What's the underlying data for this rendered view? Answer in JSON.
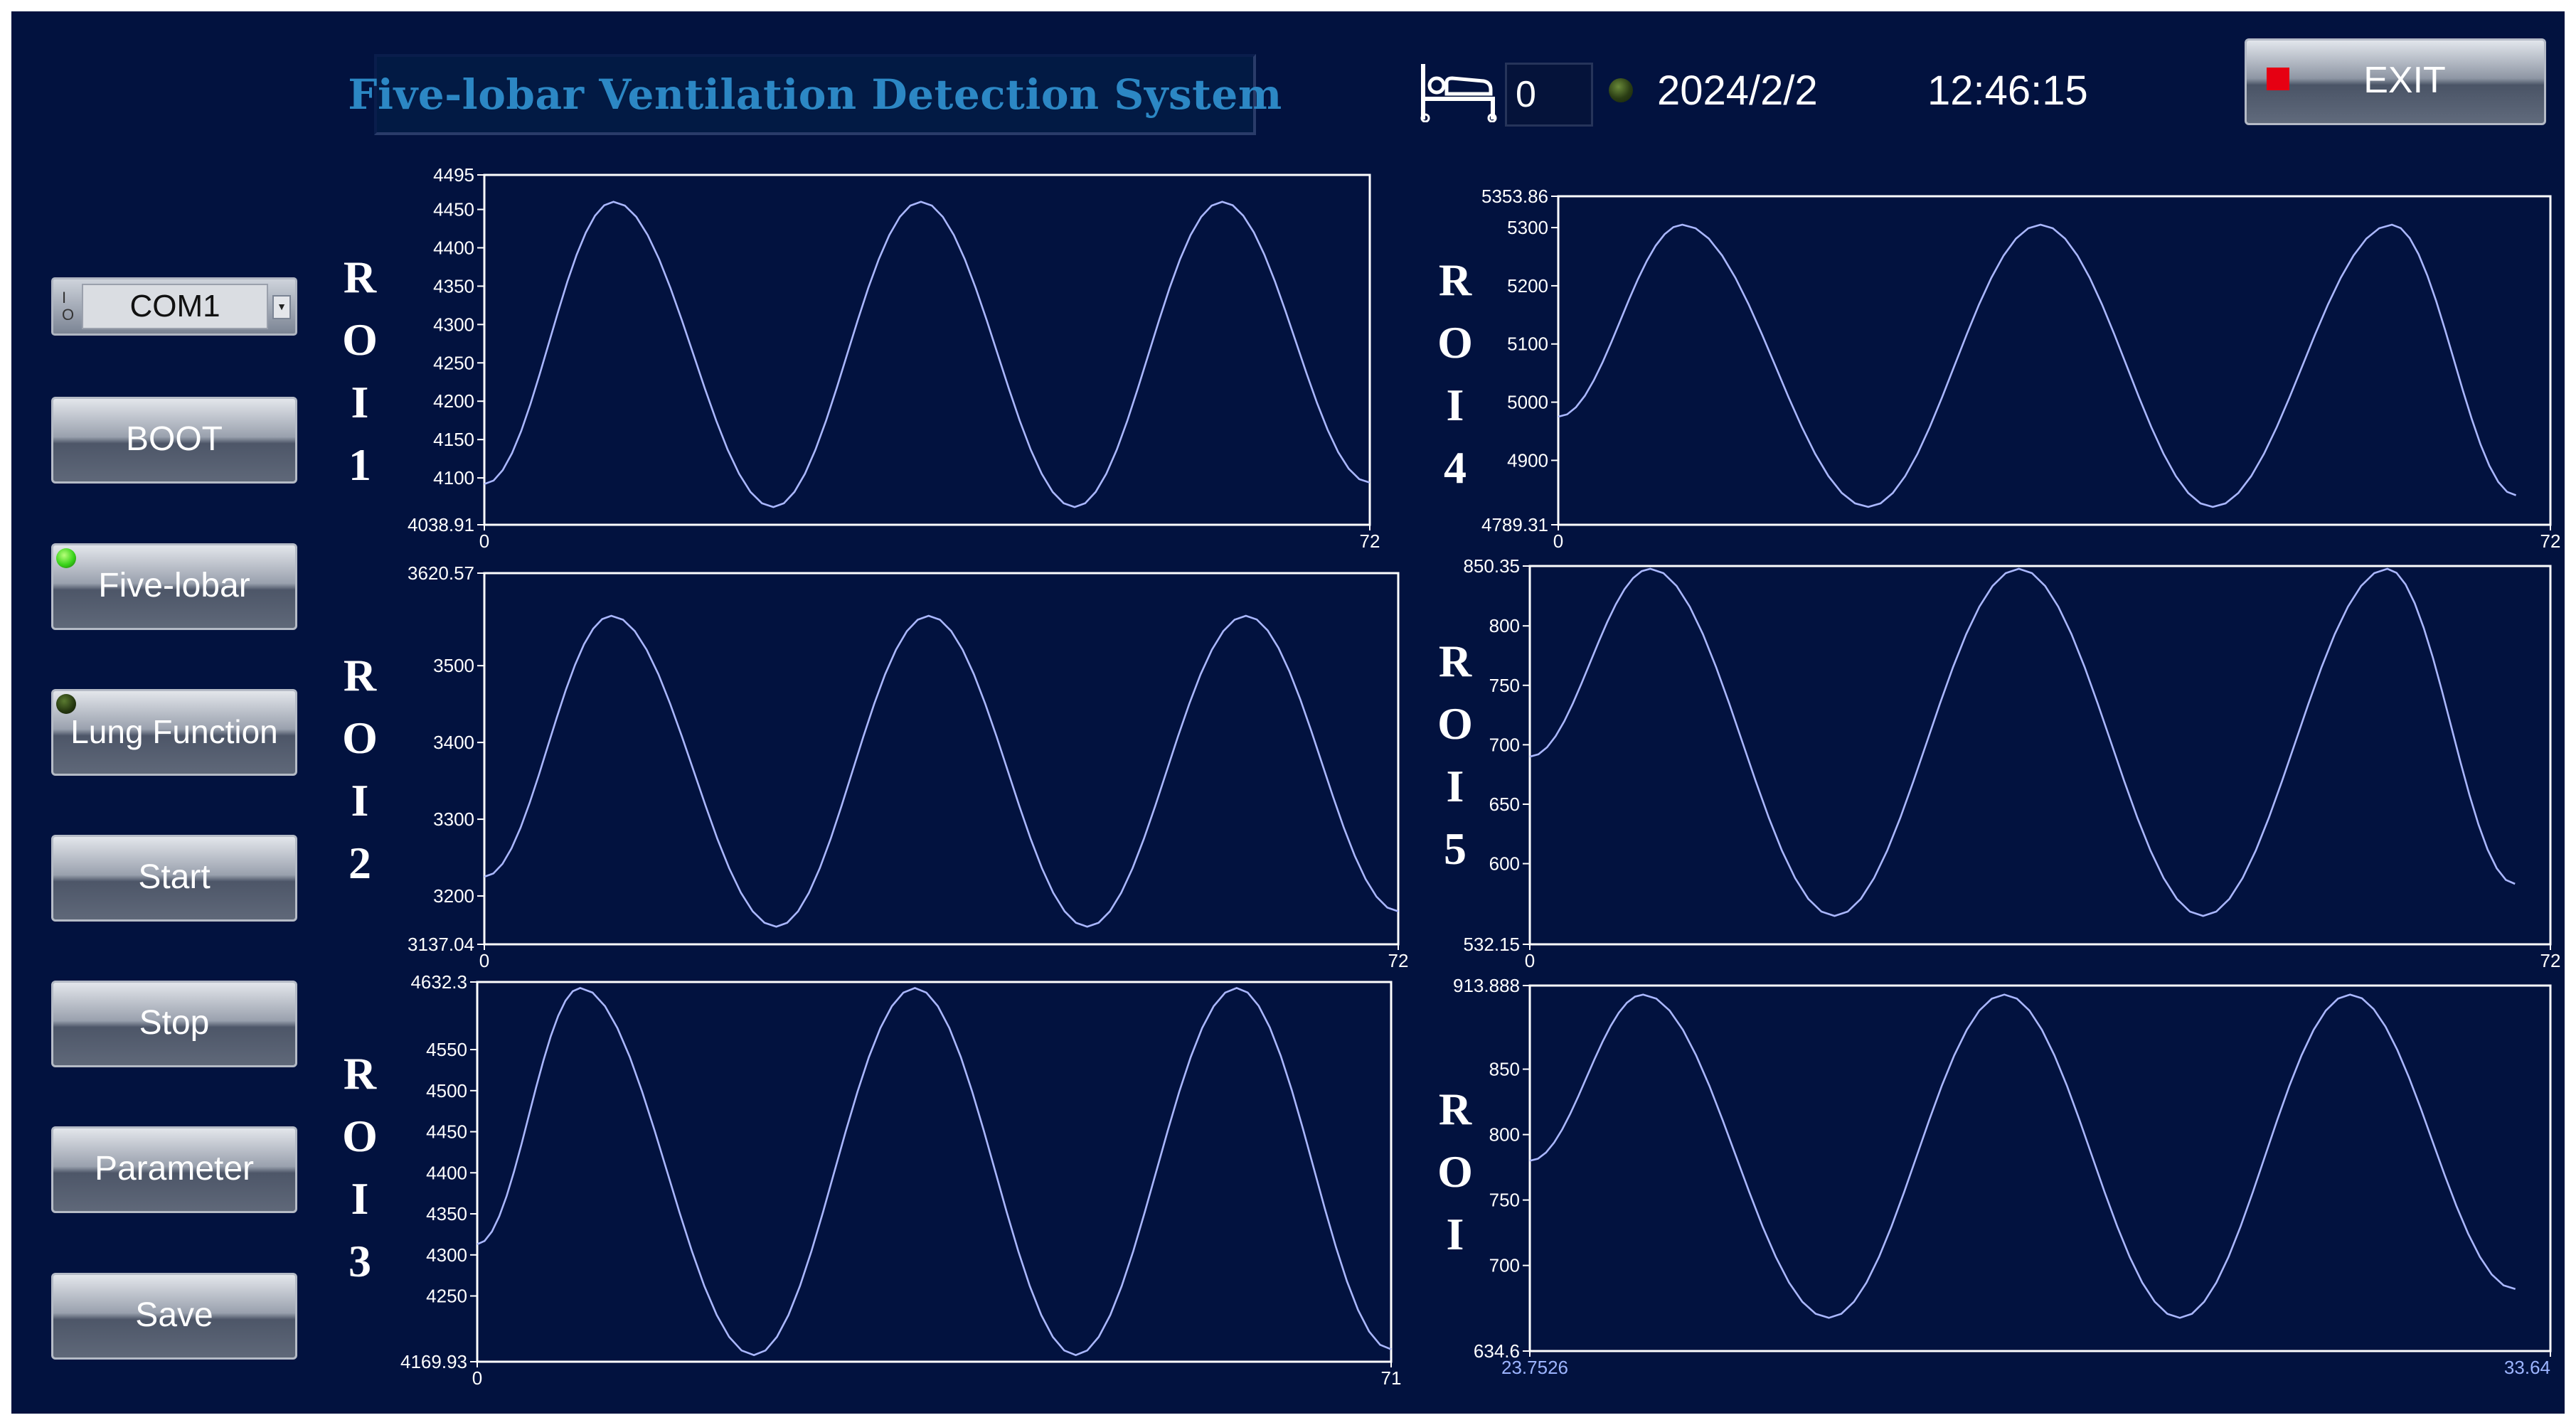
{
  "app": {
    "title": "Five-lobar Ventilation Detection System",
    "bed_count": "0",
    "date": "2024/2/2",
    "time": "12:46:15",
    "exit_label": "EXIT"
  },
  "icons": {
    "bed": "bed-icon",
    "status_led": "led-indicator",
    "exit": "stop-square-icon",
    "io": "io-icon",
    "dropdown": "chevron-down-icon"
  },
  "colors": {
    "background": "#02123f",
    "title": "#2c87c4",
    "trace": "#aab7ff",
    "exit_square": "#e60012",
    "led_on": "#39d31a"
  },
  "sidebar": {
    "port": {
      "value": "COM1"
    },
    "buttons": [
      {
        "label": "BOOT"
      },
      {
        "label": "Five-lobar",
        "indicator": "on"
      },
      {
        "label": "Lung Function",
        "indicator": "off"
      },
      {
        "label": "Start"
      },
      {
        "label": "Stop"
      },
      {
        "label": "Parameter"
      },
      {
        "label": "Save"
      }
    ]
  },
  "roi_labels": [
    [
      "R",
      "O",
      "I",
      "1"
    ],
    [
      "R",
      "O",
      "I",
      "2"
    ],
    [
      "R",
      "O",
      "I",
      "3"
    ],
    [
      "R",
      "O",
      "I",
      "4"
    ],
    [
      "R",
      "O",
      "I",
      "5"
    ],
    [
      "R",
      "O",
      "I"
    ]
  ],
  "chart_data": [
    {
      "type": "line",
      "ymin_label": "4038.91",
      "ymax_label": "4495",
      "ylim": [
        4038.91,
        4495
      ],
      "yticks": [
        "4100",
        "4150",
        "4200",
        "4250",
        "4300",
        "4350",
        "4400",
        "4450"
      ],
      "xlim": [
        0,
        72
      ],
      "xticks": [
        "0",
        "72"
      ],
      "series": [
        {
          "x0": 0,
          "x1": 72,
          "min": 4062,
          "max": 4460,
          "start": 4092,
          "peaks": [
            10.5,
            35.5,
            60.0
          ],
          "troughs": [
            23.5,
            48.0
          ]
        }
      ]
    },
    {
      "type": "line",
      "ymin_label": "3137.04",
      "ymax_label": "3620.57",
      "ylim": [
        3137.04,
        3620.57
      ],
      "yticks": [
        "3200",
        "3300",
        "3400",
        "3500"
      ],
      "xlim": [
        0,
        72
      ],
      "xticks": [
        "0",
        "72"
      ],
      "series": [
        {
          "x0": 0,
          "x1": 72,
          "min": 3160,
          "max": 3565,
          "start": 3225,
          "peaks": [
            10.0,
            35.0,
            60.0
          ],
          "troughs": [
            23.0,
            47.5
          ],
          "end": 3180
        }
      ]
    },
    {
      "type": "line",
      "ymin_label": "4169.93",
      "ymax_label": "4632.3",
      "ylim": [
        4169.93,
        4632.3
      ],
      "yticks": [
        "4250",
        "4300",
        "4350",
        "4400",
        "4450",
        "4500",
        "4550"
      ],
      "xlim": [
        0,
        71
      ],
      "xticks": [
        "0",
        "71"
      ],
      "series": [
        {
          "x0": 0,
          "x1": 71,
          "min": 4178,
          "max": 4625,
          "start": 4313,
          "peaks": [
            8.0,
            34.0,
            59.0
          ],
          "troughs": [
            21.5,
            46.5
          ],
          "end": 4185
        }
      ]
    },
    {
      "type": "line",
      "ymin_label": "4789.31",
      "ymax_label": "5353.86",
      "ylim": [
        4789.31,
        5353.86
      ],
      "yticks": [
        "4900",
        "5000",
        "5100",
        "5200",
        "5300"
      ],
      "xlim": [
        0,
        72
      ],
      "xticks": [
        "0",
        "72"
      ],
      "series": [
        {
          "x0": 0,
          "x1": 69.5,
          "min": 4820,
          "max": 5305,
          "start": 4975,
          "peaks": [
            9.0,
            35.0,
            60.5
          ],
          "troughs": [
            22.5,
            47.5
          ],
          "end": 4840
        }
      ]
    },
    {
      "type": "line",
      "ymin_label": "532.15",
      "ymax_label": "850.35",
      "ylim": [
        532.15,
        850.35
      ],
      "yticks": [
        "600",
        "650",
        "700",
        "750",
        "800"
      ],
      "xlim": [
        0,
        72
      ],
      "xticks": [
        "0",
        "72"
      ],
      "series": [
        {
          "x0": 0,
          "x1": 69.5,
          "min": 556,
          "max": 848,
          "start": 690,
          "peaks": [
            8.5,
            34.5,
            60.5
          ],
          "troughs": [
            21.5,
            47.5
          ],
          "end": 583
        }
      ]
    },
    {
      "type": "line",
      "ymin_label": "634.6",
      "ymax_label": "913.888",
      "ylim": [
        634.6,
        913.888
      ],
      "yticks": [
        "700",
        "750",
        "800",
        "850"
      ],
      "xlim": [
        23.7526,
        33.64
      ],
      "xticks": [
        "23.7526",
        "33.64"
      ],
      "series": [
        {
          "x0": 23.7526,
          "x1": 33.3,
          "min": 660,
          "max": 907,
          "start": 780,
          "peaks": [
            24.85,
            28.35,
            31.7
          ],
          "troughs": [
            26.65,
            30.05
          ],
          "end": 682
        }
      ]
    }
  ]
}
